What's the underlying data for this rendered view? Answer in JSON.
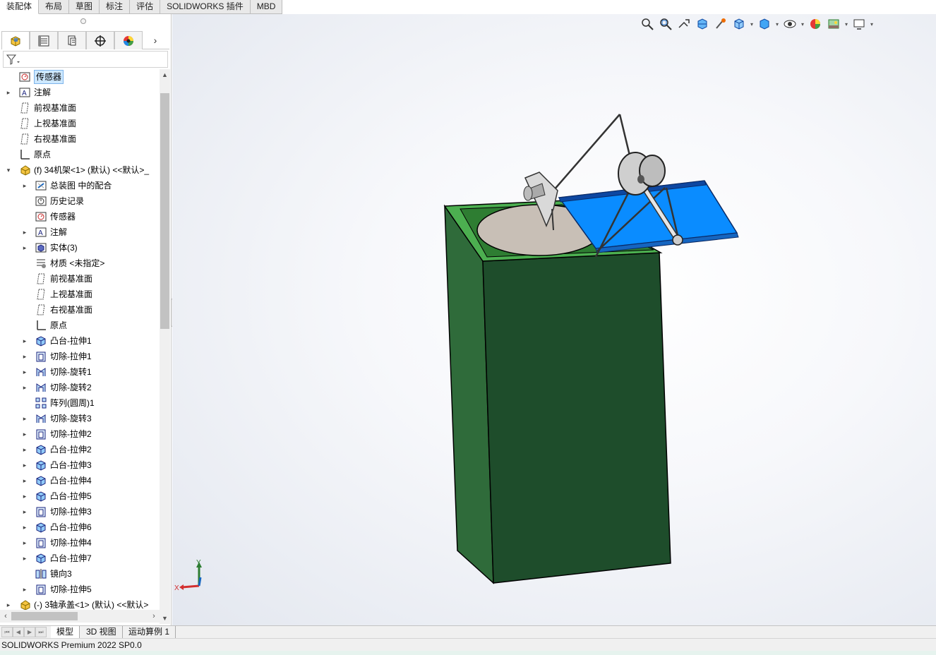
{
  "command_tabs": [
    {
      "label": "装配体",
      "active": true
    },
    {
      "label": "布局"
    },
    {
      "label": "草图"
    },
    {
      "label": "标注"
    },
    {
      "label": "评估"
    },
    {
      "label": "SOLIDWORKS 插件"
    },
    {
      "label": "MBD"
    }
  ],
  "panel_tabs": [
    "feature-manager-icon",
    "property-manager-icon",
    "configuration-manager-icon",
    "dimxpert-icon",
    "display-manager-icon"
  ],
  "tree": [
    {
      "label": "传感器",
      "icon": "sensor",
      "indent": 0,
      "arrow": false,
      "selected": true
    },
    {
      "label": "注解",
      "icon": "annotation",
      "indent": 0,
      "arrow": true
    },
    {
      "label": "前视基准面",
      "icon": "plane",
      "indent": 0,
      "arrow": false
    },
    {
      "label": "上视基准面",
      "icon": "plane",
      "indent": 0,
      "arrow": false
    },
    {
      "label": "右视基准面",
      "icon": "plane",
      "indent": 0,
      "arrow": false
    },
    {
      "label": "原点",
      "icon": "origin",
      "indent": 0,
      "arrow": false
    },
    {
      "label": "(f) 34机架<1> (默认) <<默认>_",
      "icon": "part",
      "indent": 0,
      "arrow": true,
      "expanded": true
    },
    {
      "label": "总装图 中的配合",
      "icon": "mates",
      "indent": 1,
      "arrow": true
    },
    {
      "label": "历史记录",
      "icon": "history",
      "indent": 1,
      "arrow": false
    },
    {
      "label": "传感器",
      "icon": "sensor",
      "indent": 1,
      "arrow": false
    },
    {
      "label": "注解",
      "icon": "annotation",
      "indent": 1,
      "arrow": true
    },
    {
      "label": "实体(3)",
      "icon": "solid",
      "indent": 1,
      "arrow": true
    },
    {
      "label": "材质 <未指定>",
      "icon": "material",
      "indent": 1,
      "arrow": false
    },
    {
      "label": "前视基准面",
      "icon": "plane",
      "indent": 1,
      "arrow": false
    },
    {
      "label": "上视基准面",
      "icon": "plane",
      "indent": 1,
      "arrow": false
    },
    {
      "label": "右视基准面",
      "icon": "plane",
      "indent": 1,
      "arrow": false
    },
    {
      "label": "原点",
      "icon": "origin",
      "indent": 1,
      "arrow": false
    },
    {
      "label": "凸台-拉伸1",
      "icon": "boss",
      "indent": 1,
      "arrow": true
    },
    {
      "label": "切除-拉伸1",
      "icon": "cut",
      "indent": 1,
      "arrow": true
    },
    {
      "label": "切除-旋转1",
      "icon": "revolve",
      "indent": 1,
      "arrow": true
    },
    {
      "label": "切除-旋转2",
      "icon": "revolve",
      "indent": 1,
      "arrow": true
    },
    {
      "label": "阵列(圆周)1",
      "icon": "pattern",
      "indent": 1,
      "arrow": false
    },
    {
      "label": "切除-旋转3",
      "icon": "revolve",
      "indent": 1,
      "arrow": true
    },
    {
      "label": "切除-拉伸2",
      "icon": "cut",
      "indent": 1,
      "arrow": true
    },
    {
      "label": "凸台-拉伸2",
      "icon": "boss",
      "indent": 1,
      "arrow": true
    },
    {
      "label": "凸台-拉伸3",
      "icon": "boss",
      "indent": 1,
      "arrow": true
    },
    {
      "label": "凸台-拉伸4",
      "icon": "boss",
      "indent": 1,
      "arrow": true
    },
    {
      "label": "凸台-拉伸5",
      "icon": "boss",
      "indent": 1,
      "arrow": true
    },
    {
      "label": "切除-拉伸3",
      "icon": "cut",
      "indent": 1,
      "arrow": true
    },
    {
      "label": "凸台-拉伸6",
      "icon": "boss",
      "indent": 1,
      "arrow": true
    },
    {
      "label": "切除-拉伸4",
      "icon": "cut",
      "indent": 1,
      "arrow": true
    },
    {
      "label": "凸台-拉伸7",
      "icon": "boss",
      "indent": 1,
      "arrow": true
    },
    {
      "label": "镜向3",
      "icon": "mirror",
      "indent": 1,
      "arrow": false
    },
    {
      "label": "切除-拉伸5",
      "icon": "cut",
      "indent": 1,
      "arrow": true
    },
    {
      "label": "(-) 3轴承盖<1> (默认) <<默认>",
      "icon": "part",
      "indent": 0,
      "arrow": true
    }
  ],
  "hud_icons": [
    "zoom-to-fit-icon",
    "zoom-to-area-icon",
    "previous-view-icon",
    "section-view-icon",
    "dynamic-annotation-icon",
    "view-orientation-icon",
    "display-style-icon",
    "hide-show-icon",
    "edit-appearance-icon",
    "apply-scene-icon",
    "view-settings-icon"
  ],
  "triad": {
    "x": "X",
    "y": "Y"
  },
  "bottom_tabs": [
    {
      "label": "模型",
      "active": true
    },
    {
      "label": "3D 视图"
    },
    {
      "label": "运动算例 1"
    }
  ],
  "status_text": "SOLIDWORKS Premium 2022 SP0.0",
  "colors": {
    "base_dark_green": "#1e4d2b",
    "base_side_green": "#2f6b3a",
    "rim_green": "#4caf50",
    "tray_blue": "#0a8cff",
    "disk_gray": "#c8bfb6"
  }
}
